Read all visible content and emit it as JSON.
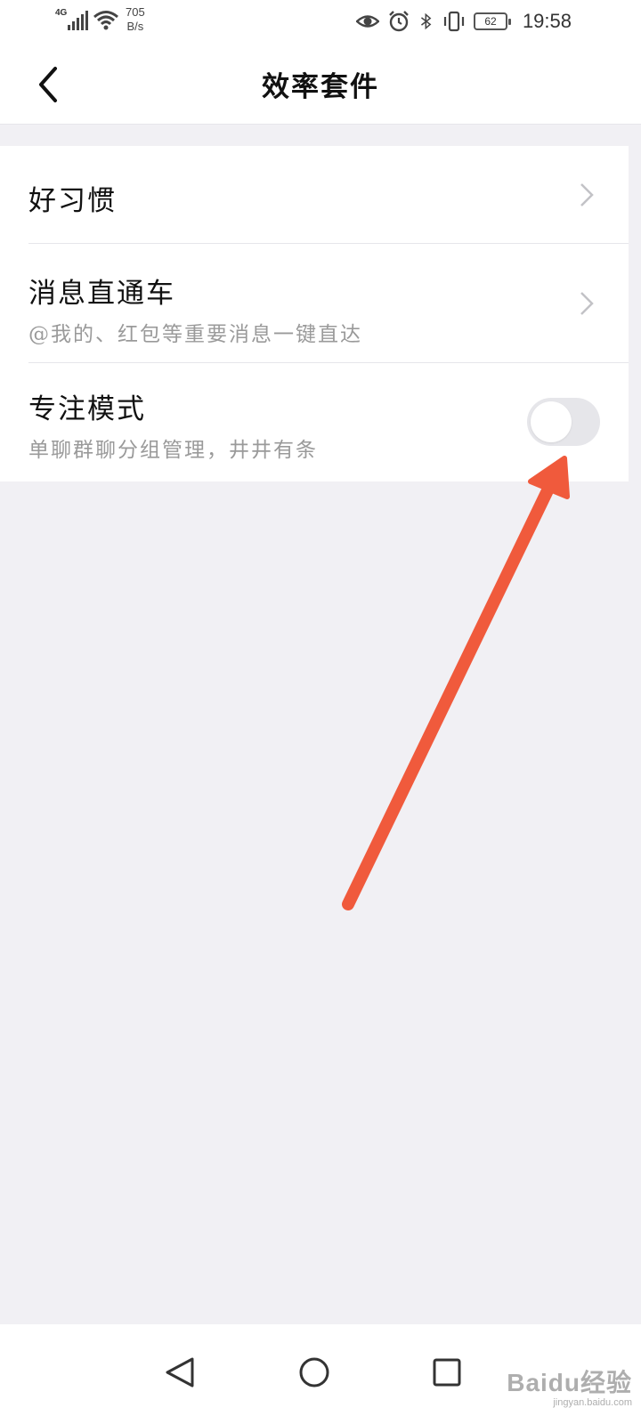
{
  "status_bar": {
    "network": "4G",
    "speed_value": "705",
    "speed_unit": "B/s",
    "battery": "62",
    "time": "19:58",
    "icons": [
      "signal-icon",
      "wifi-icon",
      "eye-icon",
      "alarm-icon",
      "bluetooth-icon",
      "vibrate-icon",
      "battery-icon"
    ]
  },
  "header": {
    "back_icon": "chevron-left-icon",
    "title": "效率套件"
  },
  "settings": {
    "items": [
      {
        "title": "好习惯",
        "subtitle": "",
        "control": "chevron-right-icon"
      },
      {
        "title": "消息直通车",
        "subtitle": "@我的、红包等重要消息一键直达",
        "control": "chevron-right-icon"
      },
      {
        "title": "专注模式",
        "subtitle": "单聊群聊分组管理，井井有条",
        "control": "toggle",
        "enabled": false
      }
    ]
  },
  "annotation": {
    "arrow_color": "#f05a3c"
  },
  "system_nav": {
    "buttons": [
      "back-triangle-icon",
      "home-circle-icon",
      "recents-square-icon"
    ]
  },
  "watermark": {
    "brand": "Baidu经验",
    "url": "jingyan.baidu.com"
  },
  "colors": {
    "background": "#f1f0f4",
    "card": "#ffffff",
    "subtitle_text": "#9a9a9a",
    "toggle_off": "#e6e6ea"
  }
}
